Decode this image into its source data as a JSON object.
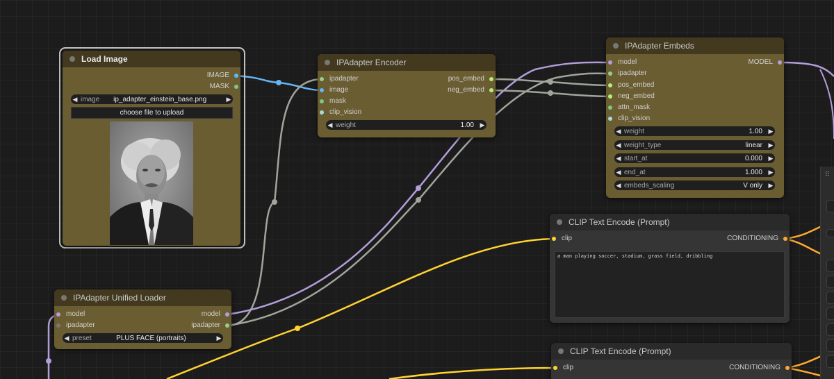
{
  "colors": {
    "model": "#b39ddb",
    "ipadapter": "#9bcc8f",
    "image": "#64b5f6",
    "mask": "#81c784",
    "clip": "#ffd330",
    "conditioning": "#ffa931",
    "clip_vision": "#a8dadc",
    "embed": "#b6ef7a",
    "wire_grey": "#a0a69c"
  },
  "load_image": {
    "title": "Load Image",
    "outputs": [
      "IMAGE",
      "MASK"
    ],
    "image_label": "image",
    "image_value": "ip_adapter_einstein_base.png",
    "upload_button": "choose file to upload"
  },
  "encoder": {
    "title": "IPAdapter Encoder",
    "inputs": [
      "ipadapter",
      "image",
      "mask",
      "clip_vision"
    ],
    "outputs": [
      "pos_embed",
      "neg_embed"
    ],
    "weight_label": "weight",
    "weight_value": "1.00"
  },
  "embeds": {
    "title": "IPAdapter Embeds",
    "inputs": [
      "model",
      "ipadapter",
      "pos_embed",
      "neg_embed",
      "attn_mask",
      "clip_vision"
    ],
    "outputs": [
      "MODEL"
    ],
    "widgets": [
      {
        "label": "weight",
        "value": "1.00"
      },
      {
        "label": "weight_type",
        "value": "linear"
      },
      {
        "label": "start_at",
        "value": "0.000"
      },
      {
        "label": "end_at",
        "value": "1.000"
      },
      {
        "label": "embeds_scaling",
        "value": "V only"
      }
    ]
  },
  "loader": {
    "title": "IPAdapter Unified Loader",
    "inputs": [
      "model",
      "ipadapter"
    ],
    "outputs": [
      "model",
      "ipadapter"
    ],
    "preset_label": "preset",
    "preset_value": "PLUS FACE (portraits)"
  },
  "clip1": {
    "title": "CLIP Text Encode (Prompt)",
    "input": "clip",
    "output": "CONDITIONING",
    "text": "a man playing soccer, stadium, grass field, dribbling"
  },
  "clip2": {
    "title": "CLIP Text Encode (Prompt)",
    "input": "clip",
    "output": "CONDITIONING"
  },
  "panel": {
    "grip_icon": "drag-grip-icon"
  }
}
